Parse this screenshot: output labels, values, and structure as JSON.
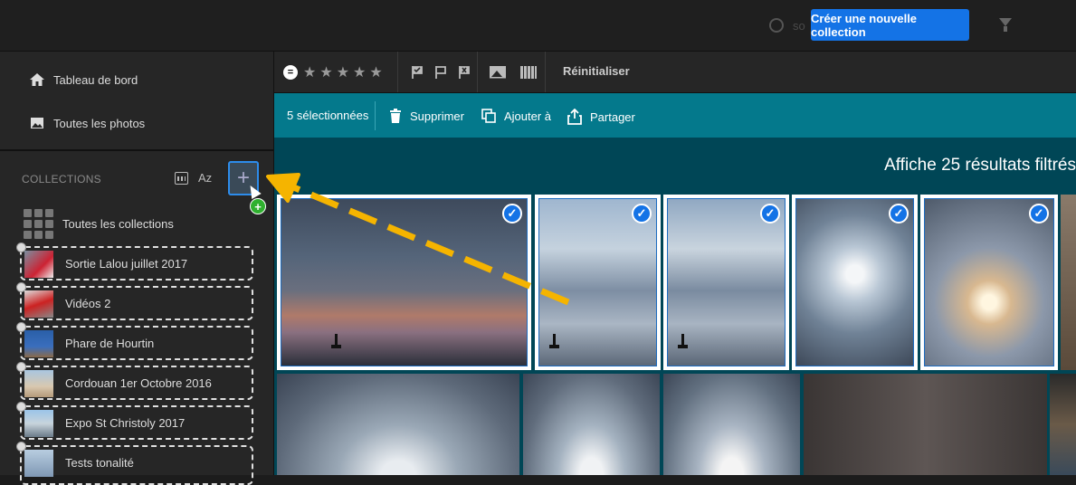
{
  "topbar": {
    "search_placeholder": "so",
    "create_button": "Créer une nouvelle collection"
  },
  "sidebar": {
    "nav": [
      {
        "label": "Tableau de bord",
        "icon": "home-icon"
      },
      {
        "label": "Toutes les photos",
        "icon": "photo-icon"
      }
    ],
    "collections_header": "COLLECTIONS",
    "sort_az": "Az",
    "add_symbol": "+",
    "badge_symbol": "+",
    "all_collections": "Toutes les collections",
    "collections": [
      {
        "label": "Sortie Lalou juillet 2017"
      },
      {
        "label": "Vidéos 2"
      },
      {
        "label": "Phare de Hourtin"
      },
      {
        "label": "Cordouan 1er Octobre 2016"
      },
      {
        "label": "Expo St Christoly 2017"
      },
      {
        "label": "Tests tonalité"
      }
    ]
  },
  "toolbar": {
    "filter_eq": "=",
    "stars": [
      "★",
      "★",
      "★",
      "★",
      "★"
    ],
    "reset": "Réinitialiser"
  },
  "selection": {
    "count": "5 sélectionnées",
    "delete": "Supprimer",
    "add_to": "Ajouter à",
    "share": "Partager"
  },
  "content": {
    "results": "Affiche 25 résultats filtrés",
    "check_glyph": "✓"
  },
  "colors": {
    "accent": "#1473e6",
    "selection_bar": "#04798c",
    "arrow": "#f5b400"
  }
}
